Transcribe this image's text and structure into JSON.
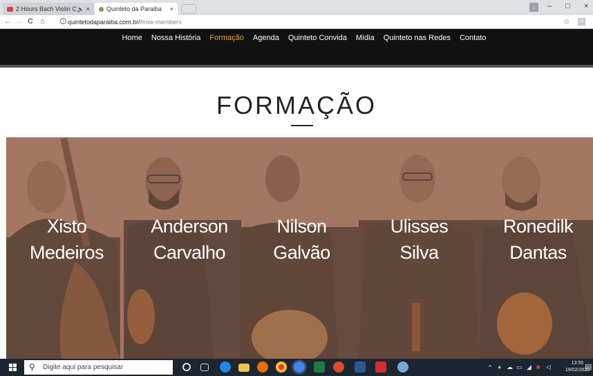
{
  "browser": {
    "tabs": [
      {
        "label": "2 Hours Bach Violin C",
        "audio": "🔈",
        "fav_color": "#e53935"
      },
      {
        "label": "Quinteto da Paraiba",
        "fav_color": "#8a9a3a"
      }
    ],
    "tab_close": "×",
    "window_controls": {
      "minimize": "–",
      "maximize": "□",
      "close": "×"
    },
    "profile_label": "↓",
    "back": "←",
    "forward": "→",
    "reload": "C",
    "home": "⌂",
    "info": "i",
    "url_host": "quintetodaparaiba.com.br/",
    "url_path": "#row-members",
    "star": "☆",
    "ext_label": "N"
  },
  "site": {
    "nav": [
      "Home",
      "Nossa História",
      "Formação",
      "Agenda",
      "Quinteto Convida",
      "Mídia",
      "Quinteto nas Redes",
      "Contato"
    ],
    "active_nav": "Formação",
    "accent": "#f0a830",
    "heading": "FORMAÇÃO",
    "overlay_color": "#a57763",
    "members": [
      {
        "first": "Xisto",
        "last": "Medeiros"
      },
      {
        "first": "Anderson",
        "last": "Carvalho"
      },
      {
        "first": "Nilson",
        "last": "Galvão"
      },
      {
        "first": "Ulisses",
        "last": "Silva"
      },
      {
        "first": "Ronedilk",
        "last": "Dantas"
      }
    ]
  },
  "taskbar": {
    "search_placeholder": "Digite aqui para pesquisar",
    "time": "13:55",
    "date": "19/02/2020",
    "apps": [
      "cortana-icon",
      "task-view-icon",
      "edge-icon",
      "file-explorer-icon",
      "firefox-icon",
      "chrome-icon",
      "chrome-alt-icon",
      "excel-icon",
      "powerpoint-icon",
      "word-icon",
      "acrobat-icon",
      "paint-icon"
    ]
  }
}
